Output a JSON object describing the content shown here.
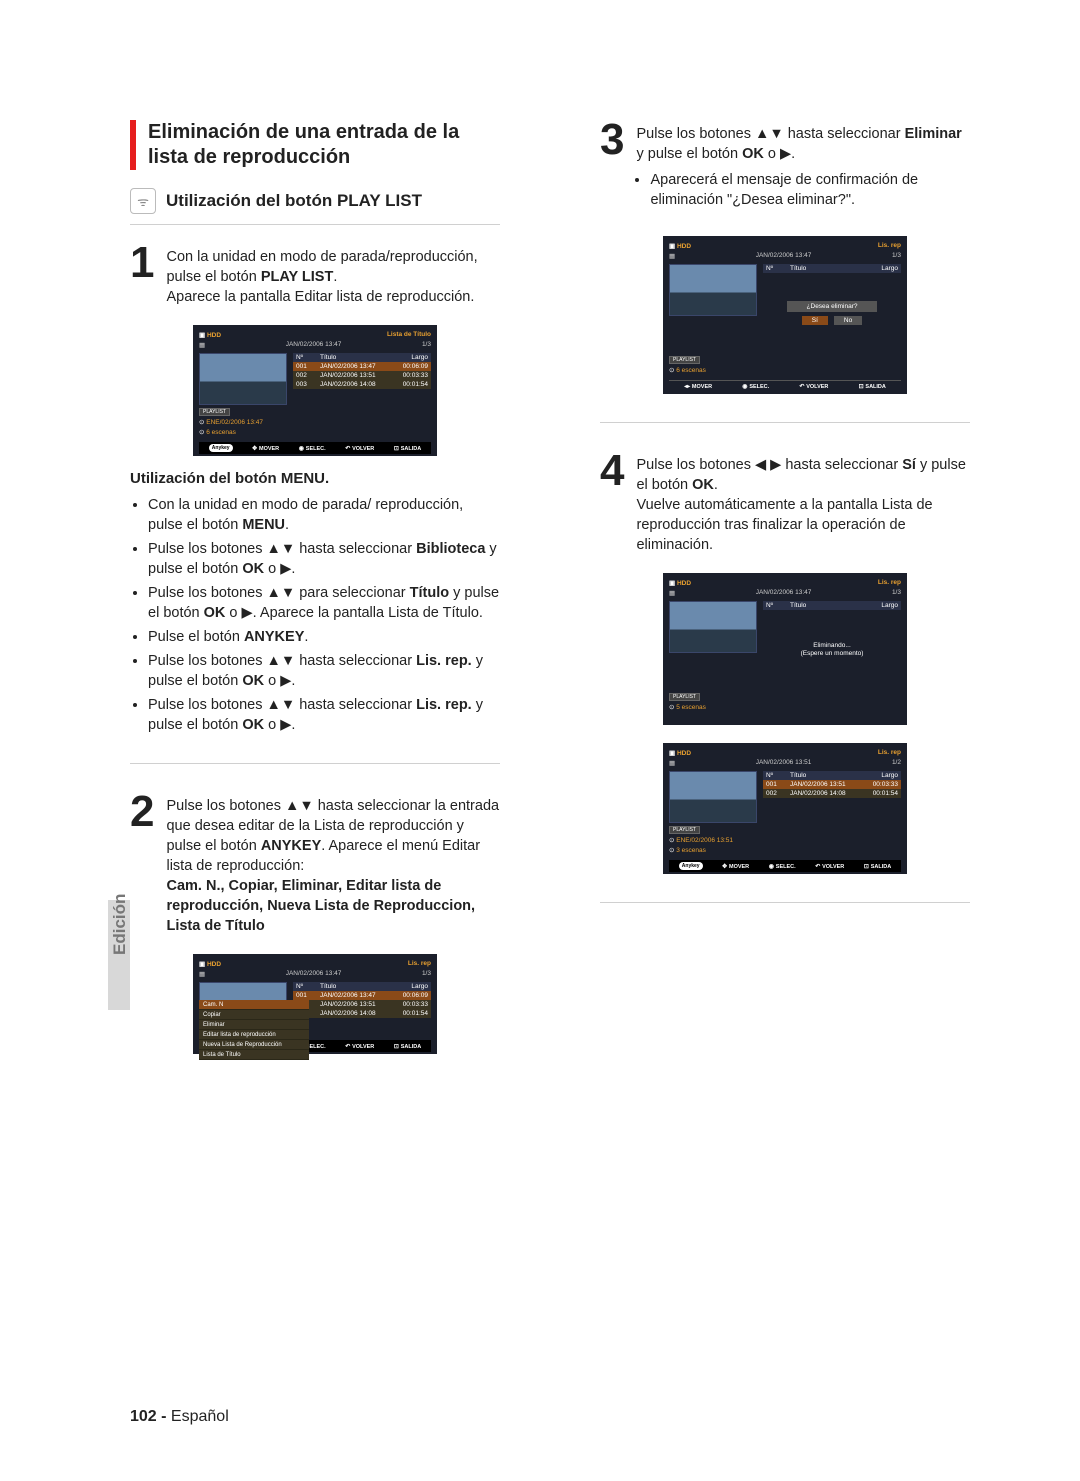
{
  "sideTab": "Edición",
  "header": {
    "title": "Eliminación de una entrada de la lista de reproducción",
    "iconLabel": "ᯤ",
    "subhead": "Utilización del botón PLAY LIST"
  },
  "step1": {
    "num": "1",
    "text_a": "Con la unidad en modo de parada/reproducción, pulse el botón ",
    "bold_a": "PLAY LIST",
    "text_b": ".",
    "text_c": "Aparece la pantalla Editar lista de reproducción."
  },
  "menuHead": "Utilización del botón MENU.",
  "bullets": [
    {
      "pre": "Con la unidad en modo de parada/ reproducción, pulse el botón ",
      "b": "MENU",
      "post": "."
    },
    {
      "pre": "Pulse los botones ▲▼ hasta seleccionar ",
      "b": "Biblioteca",
      "post": " y pulse el botón ",
      "b2": "OK",
      "post2": " o ▶."
    },
    {
      "pre": "Pulse los botones ▲▼ para seleccionar ",
      "b": "Título",
      "post": " y pulse el botón ",
      "b2": "OK",
      "post2": " o ▶. Aparece la pantalla Lista de Título."
    },
    {
      "pre": "Pulse el botón ",
      "b": "ANYKEY",
      "post": "."
    },
    {
      "pre": "Pulse los botones ▲▼ hasta seleccionar ",
      "b": "Lis. rep.",
      "post": " y pulse el botón ",
      "b2": "OK",
      "post2": " o ▶."
    },
    {
      "pre": "Pulse los botones ▲▼ hasta seleccionar ",
      "b": "Lis. rep.",
      "post": " y pulse el botón ",
      "b2": "OK",
      "post2": " o ▶."
    }
  ],
  "step2": {
    "num": "2",
    "text": "Pulse los botones ▲▼ hasta seleccionar la entrada que desea editar de la Lista de reproducción y pulse el botón ",
    "bold": "ANYKEY",
    "text2": ". Aparece el menú Editar lista de reproducción: ",
    "bold2": "Cam. N., Copiar, Eliminar, Editar lista de reproducción, Nueva Lista de Reproduccion, Lista de Título"
  },
  "step3": {
    "num": "3",
    "text": "Pulse los botones ▲▼ hasta seleccionar ",
    "bold": "Eliminar",
    "text2": " y pulse el botón ",
    "bold2": "OK",
    "text3": " o ▶.",
    "sub": "Aparecerá el mensaje de confirmación de eliminación \"¿Desea eliminar?\"."
  },
  "step4": {
    "num": "4",
    "text": "Pulse los botones ◀ ▶ hasta seleccionar ",
    "bold": "Sí",
    "text2": " y pulse el botón ",
    "bold2": "OK",
    "text3": ".",
    "sub": "Vuelve automáticamente a la pantalla Lista de reproducción tras finalizar la operación de eliminación."
  },
  "screens": {
    "common": {
      "hdd": "HDD",
      "hintMover": "MOVER",
      "hintSelec": "SELEC.",
      "hintVolver": "VOLVER",
      "hintSalida": "SALIDA",
      "anykey": "Anykey",
      "colN": "Nº",
      "colT": "Título",
      "colL": "Largo"
    },
    "s1": {
      "title": "Lista de Título",
      "ts": "JAN/02/2006 13:47",
      "count": "1/3",
      "rows": [
        {
          "n": "001",
          "t": "JAN/02/2006 13:47",
          "l": "00:06:09",
          "sel": true
        },
        {
          "n": "002",
          "t": "JAN/02/2006 13:51",
          "l": "00:03:33",
          "sel": false
        },
        {
          "n": "003",
          "t": "JAN/02/2006 14:08",
          "l": "00:01:54",
          "sel": false
        }
      ],
      "plTag": "PLAYLIST",
      "plDate": "ENE/02/2006 13:47",
      "plScenes": "6 escenas"
    },
    "s2": {
      "title": "Lis. rep",
      "ts": "JAN/02/2006 13:47",
      "count": "1/3",
      "rows": [
        {
          "n": "001",
          "t": "JAN/02/2006 13:47",
          "l": "00:06:09",
          "sel": true
        },
        {
          "n": "",
          "t": "JAN/02/2006 13:51",
          "l": "00:03:33",
          "sel": false
        },
        {
          "n": "",
          "t": "JAN/02/2006 14:08",
          "l": "00:01:54",
          "sel": false
        }
      ],
      "menu": [
        "Cam. N",
        "Copiar",
        "Eliminar",
        "Editar lista de reproducción",
        "Nueva Lista de Reproducción",
        "Lista de Título"
      ],
      "menuSel": 0
    },
    "s3": {
      "title": "Lis. rep",
      "ts": "JAN/02/2006 13:47",
      "count": "1/3",
      "q": "¿Desea eliminar?",
      "yes": "Sí",
      "no": "No",
      "plTag": "PLAYLIST",
      "plScenes": "6 escenas"
    },
    "s4a": {
      "title": "Lis. rep",
      "ts": "JAN/02/2006 13:47",
      "count": "1/3",
      "msg1": "Eliminando...",
      "msg2": "(Espere un momento)",
      "plTag": "PLAYLIST",
      "plScenes": "5 escenas"
    },
    "s4b": {
      "title": "Lis. rep",
      "ts": "JAN/02/2006 13:51",
      "count": "1/2",
      "rows": [
        {
          "n": "001",
          "t": "JAN/02/2006 13:51",
          "l": "00:03:33",
          "sel": true
        },
        {
          "n": "002",
          "t": "JAN/02/2006 14:08",
          "l": "00:01:54",
          "sel": false
        }
      ],
      "plTag": "PLAYLIST",
      "plDate": "ENE/02/2006 13:51",
      "plScenes": "3 escenas"
    }
  },
  "footer": {
    "page": "102 -",
    "lang": "Español"
  }
}
